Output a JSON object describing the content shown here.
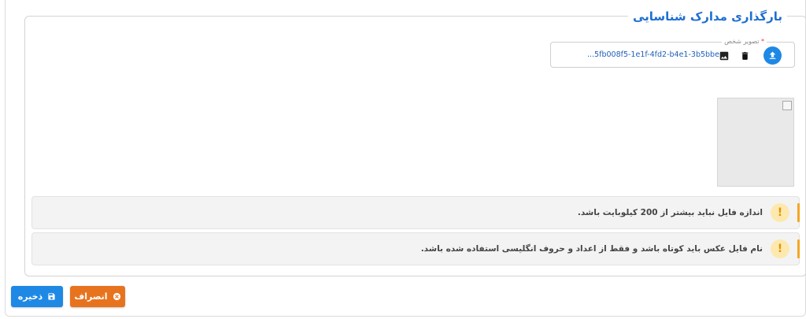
{
  "section": {
    "title": "بارگذاری مدارک شناسایی"
  },
  "upload": {
    "label": "تصویر شخص",
    "required_mark": "*",
    "filename": "...5fb008f5-1e1f-4fd2-b4e1-3b5bbe",
    "icons": [
      "upload-icon",
      "trash-icon",
      "image-icon"
    ]
  },
  "alerts": [
    {
      "text": "اندازه فایل نباید بیشتر از 200 کیلوبایت باشد.",
      "icon": "!"
    },
    {
      "text": "نام فایل عکس باید کوتاه باشد و فقط از اعداد و حروف انگلیسی استفاده شده باشد.",
      "icon": "!"
    }
  ],
  "buttons": {
    "save": "ذخیره",
    "cancel": "انصراف"
  },
  "colors": {
    "primary": "#1e88e5",
    "cancel": "#e8731f",
    "warning": "#f5a623",
    "title": "#1e6fd0"
  }
}
